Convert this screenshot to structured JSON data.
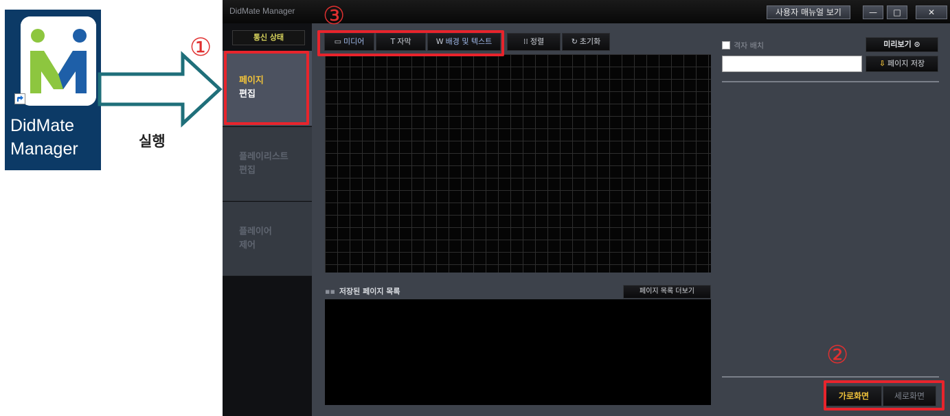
{
  "desktop": {
    "shortcut_label_line1": "DidMate",
    "shortcut_label_line2": "Manager",
    "run_label": "실행"
  },
  "annotations": {
    "one": "①",
    "two": "②",
    "three": "③",
    "color": "#e8242c"
  },
  "window": {
    "title": "DidMate Manager",
    "manual_button": "사용자 매뉴얼 보기",
    "minimize_icon": "—",
    "maximize_icon": "□",
    "close_icon": "✕"
  },
  "sidebar": {
    "comm_status": "통신 상태",
    "items": [
      {
        "line1": "페이지",
        "line2": "편집",
        "active": true
      },
      {
        "line1": "플레이리스트",
        "line2": "편집",
        "active": false
      },
      {
        "line1": "플레이어",
        "line2": "제어",
        "active": false
      }
    ]
  },
  "toolbar": {
    "media": "미디어",
    "media_icon": "image-icon",
    "subtitle": "자막",
    "subtitle_icon": "text-icon",
    "background": "배경 및 텍스트",
    "background_icon": "w-icon",
    "align": "정렬",
    "align_icon": "align-icon",
    "reset": "초기화",
    "reset_icon": "refresh-icon"
  },
  "saved_pages": {
    "title": "저장된 페이지 목록",
    "more_button": "페이지 목록 더보기"
  },
  "right_panel": {
    "grid_label": "격자 배치",
    "preview_button": "미리보기 ⊙",
    "page_name_value": "",
    "save_page_button": "페이지 저장",
    "landscape_button": "가로화면",
    "portrait_button": "세로화면"
  },
  "colors": {
    "accent_yellow": "#f0c23a",
    "panel": "#3d424b",
    "canvas": "#050505"
  }
}
